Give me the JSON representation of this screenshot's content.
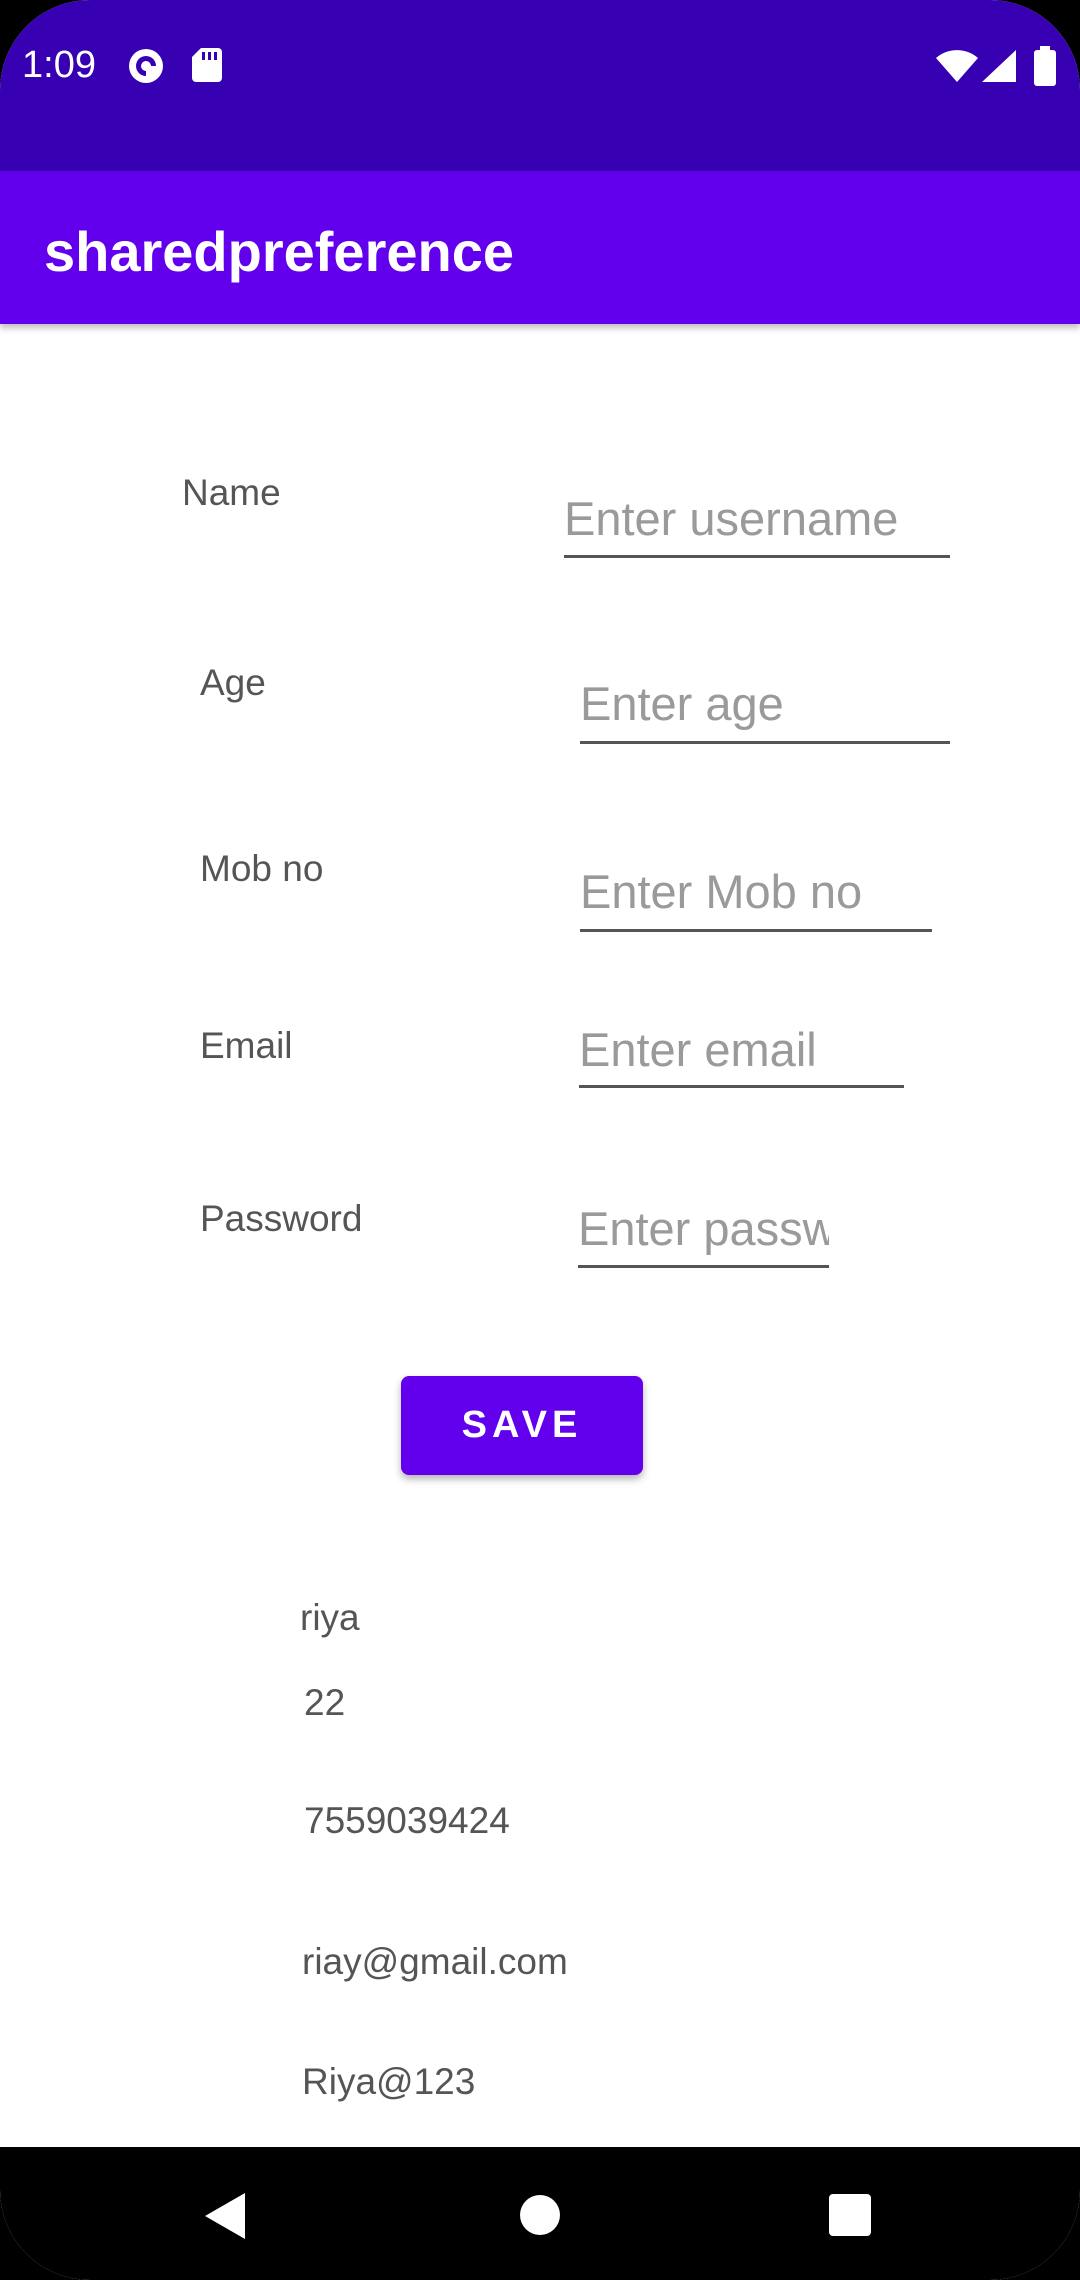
{
  "status_bar": {
    "time": "1:09",
    "left_icons": [
      "pocket-casts-icon",
      "sd-card-icon"
    ],
    "right_icons": [
      "wifi-icon",
      "signal-icon",
      "battery-icon"
    ]
  },
  "app_bar": {
    "title": "sharedpreference"
  },
  "form": {
    "name": {
      "label": "Name",
      "placeholder": "Enter username",
      "value": ""
    },
    "age": {
      "label": "Age",
      "placeholder": "Enter age",
      "value": ""
    },
    "mob": {
      "label": "Mob no",
      "placeholder": "Enter Mob no",
      "value": ""
    },
    "email": {
      "label": "Email",
      "placeholder": "Enter email",
      "value": ""
    },
    "password": {
      "label": "Password",
      "placeholder": "Enter passw",
      "value": ""
    }
  },
  "save_label": "SAVE",
  "saved": {
    "name": "riya",
    "age": "22",
    "mob": "7559039424",
    "email": "riay@gmail.com",
    "password": "Riya@123"
  },
  "nav_bar": {
    "icons": [
      "back-icon",
      "home-icon",
      "recents-icon"
    ]
  },
  "colors": {
    "status_bar": "#3700B3",
    "app_bar": "#6200EE",
    "accent": "#6200EE"
  }
}
